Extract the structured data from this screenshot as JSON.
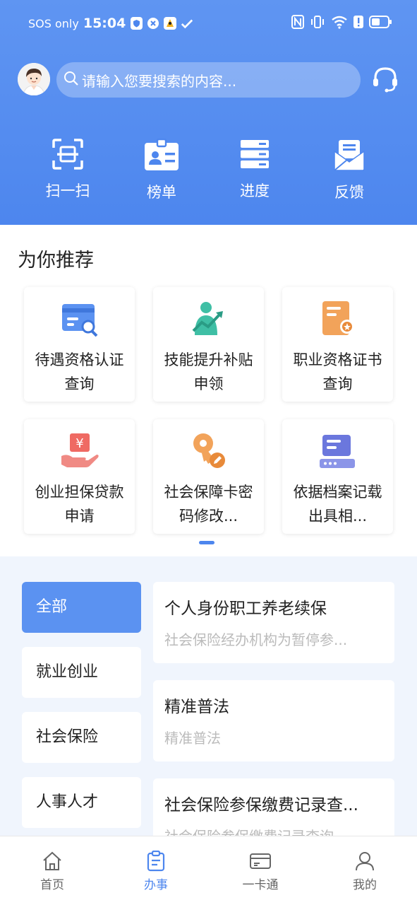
{
  "status_bar": {
    "carrier": "SOS only",
    "time": "15:04",
    "icons": [
      "shield-app-icon",
      "x-app-icon",
      "bird-app-icon",
      "check-app-icon",
      "nfc-icon",
      "vibrate-icon",
      "wifi-icon",
      "alert-icon",
      "battery-icon"
    ]
  },
  "header": {
    "search_placeholder": "请输入您要搜索的内容...",
    "quick_actions": [
      {
        "label": "扫一扫",
        "icon": "scan-icon"
      },
      {
        "label": "榜单",
        "icon": "badge-list-icon"
      },
      {
        "label": "进度",
        "icon": "progress-server-icon"
      },
      {
        "label": "反馈",
        "icon": "feedback-mail-icon"
      }
    ]
  },
  "recommend": {
    "title": "为你推荐",
    "cards": [
      {
        "label": "待遇资格认证查询",
        "icon": "card-search-icon"
      },
      {
        "label": "技能提升补贴申领",
        "icon": "person-growth-icon"
      },
      {
        "label": "职业资格证书查询",
        "icon": "certificate-icon"
      },
      {
        "label": "创业担保贷款申请",
        "icon": "yuan-hand-icon"
      },
      {
        "label": "社会保障卡密码修改...",
        "icon": "key-edit-icon"
      },
      {
        "label": "依据档案记载出具相...",
        "icon": "archive-server-icon"
      }
    ]
  },
  "categories": [
    {
      "label": "全部",
      "active": true
    },
    {
      "label": "就业创业",
      "active": false
    },
    {
      "label": "社会保险",
      "active": false
    },
    {
      "label": "人事人才",
      "active": false
    }
  ],
  "services": [
    {
      "title": "个人身份职工养老续保",
      "subtitle": "社会保险经办机构为暂停参..."
    },
    {
      "title": "精准普法",
      "subtitle": "精准普法"
    },
    {
      "title": "社会保险参保缴费记录查...",
      "subtitle": "社会保险参保缴费记录查询"
    }
  ],
  "bottom_nav": [
    {
      "label": "首页",
      "icon": "home-icon",
      "active": false
    },
    {
      "label": "办事",
      "icon": "clipboard-icon",
      "active": true
    },
    {
      "label": "一卡通",
      "icon": "card-icon",
      "active": false
    },
    {
      "label": "我的",
      "icon": "user-icon",
      "active": false
    }
  ],
  "colors": {
    "primary": "#4d86ee",
    "header_gradient_top": "#5f95f2",
    "background_light": "#f0f5fd"
  }
}
